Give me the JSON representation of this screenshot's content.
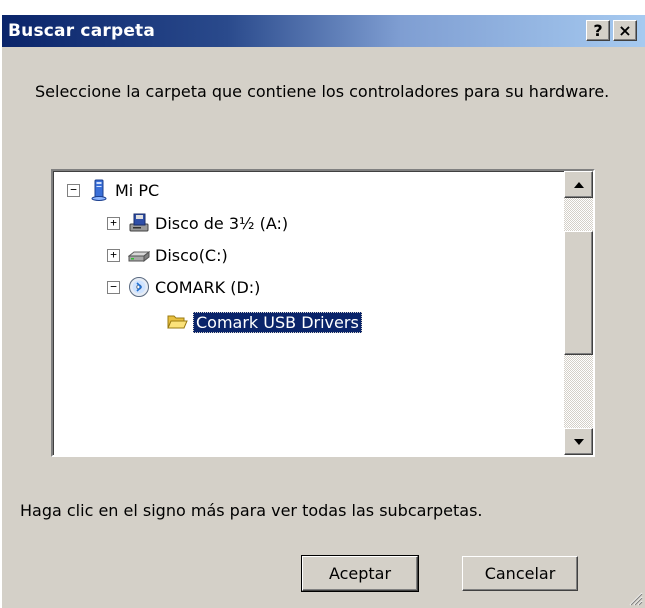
{
  "dialog": {
    "title": "Buscar carpeta",
    "help_glyph": "?",
    "close_glyph": "×",
    "instruction": "Seleccione la carpeta que contiene los controladores para su hardware.",
    "hint": "Haga clic en el signo más para ver todas las subcarpetas.",
    "ok_label": "Aceptar",
    "cancel_label": "Cancelar"
  },
  "tree": {
    "root": {
      "label": "Mi PC",
      "expander": "−",
      "icon": "my-computer-icon"
    },
    "items": [
      {
        "label": "Disco de 3½ (A:)",
        "expander": "+",
        "icon": "floppy-drive-icon"
      },
      {
        "label": "Disco(C:)",
        "expander": "+",
        "icon": "hard-drive-icon"
      },
      {
        "label": "COMARK (D:)",
        "expander": "−",
        "icon": "cd-drive-icon"
      }
    ],
    "selected": {
      "label": "Comark USB Drivers",
      "icon": "folder-open-icon"
    }
  },
  "colors": {
    "titlebar_start": "#0a246a",
    "titlebar_end": "#a6caf0",
    "selection": "#0a246a",
    "face": "#d4d0c8"
  }
}
